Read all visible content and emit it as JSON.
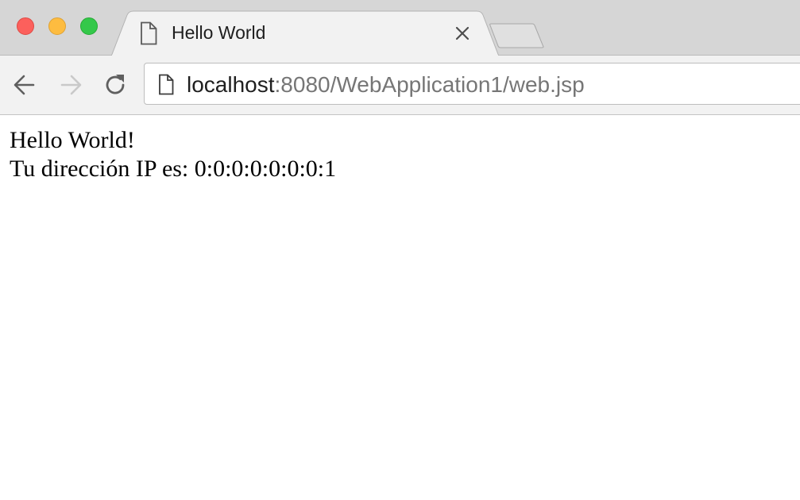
{
  "window": {
    "traffic_lights": {
      "close_color": "#fc605c",
      "minimize_color": "#fdbc40",
      "maximize_color": "#34c84a"
    }
  },
  "tab": {
    "title": "Hello World",
    "icon": "page-icon",
    "close_icon": "close-icon"
  },
  "toolbar": {
    "back_icon": "back-arrow-icon",
    "forward_icon": "forward-arrow-icon",
    "reload_icon": "reload-icon"
  },
  "address_bar": {
    "icon": "page-icon",
    "host": "localhost",
    "rest": ":8080/WebApplication1/web.jsp"
  },
  "page": {
    "line1": "Hello World!",
    "line2": "Tu dirección IP es: 0:0:0:0:0:0:0:1"
  }
}
